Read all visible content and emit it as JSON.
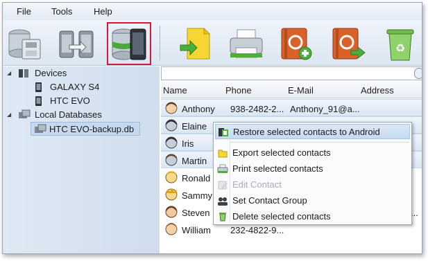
{
  "menu": {
    "items": [
      "File",
      "Tools",
      "Help"
    ]
  },
  "toolbar": {
    "buttons": [
      {
        "icon": "backup-database-icon"
      },
      {
        "icon": "transfer-phones-icon"
      },
      {
        "icon": "database-phone-icon",
        "selected": true
      },
      {
        "icon": "export-file-icon"
      },
      {
        "icon": "printer-icon"
      },
      {
        "icon": "add-contact-book-icon"
      },
      {
        "icon": "export-contact-book-icon"
      },
      {
        "icon": "recycle-bin-icon"
      }
    ]
  },
  "tree": {
    "devices_label": "Devices",
    "devices": [
      "GALAXY S4",
      "HTC EVO"
    ],
    "local_label": "Local Databases",
    "local_items": [
      "HTC EVO-backup.db"
    ]
  },
  "table": {
    "headers": {
      "name": "Name",
      "phone": "Phone",
      "email": "E-Mail",
      "address": "Address"
    },
    "rows": [
      {
        "name": "Anthony",
        "phone": "938-2482-2...",
        "email": "Anthony_91@a...",
        "selected": true
      },
      {
        "name": "Elaine",
        "phone": "",
        "email": "",
        "selected": true
      },
      {
        "name": "Iris",
        "phone": "",
        "email": "",
        "selected": true
      },
      {
        "name": "Martin",
        "phone": "",
        "email": "",
        "selected": true
      },
      {
        "name": "Ronald",
        "phone": "",
        "email": "",
        "selected": false
      },
      {
        "name": "Sammy",
        "phone": "",
        "email": "",
        "selected": false
      },
      {
        "name": "Steven",
        "phone": "",
        "email": "",
        "address": "...",
        "selected": false
      },
      {
        "name": "William",
        "phone": "232-4822-9...",
        "email": "",
        "selected": false
      }
    ]
  },
  "context_menu": {
    "items": [
      {
        "label": "Restore selected contacts to Android",
        "icon": "restore-android-icon",
        "highlighted": true
      },
      {
        "label": "Export selected contacts",
        "icon": "export-folder-icon"
      },
      {
        "label": "Print selected contacts",
        "icon": "print-icon"
      },
      {
        "label": "Edit Contact",
        "icon": "edit-contact-icon",
        "disabled": true
      },
      {
        "label": "Set Contact Group",
        "icon": "contact-group-icon"
      },
      {
        "label": "Delete selected contacts",
        "icon": "delete-icon"
      }
    ]
  },
  "colors": {
    "selection_outline": "#d9173a",
    "context_highlight": "#c5d9f0",
    "tree_background": "#d5e2f0"
  }
}
